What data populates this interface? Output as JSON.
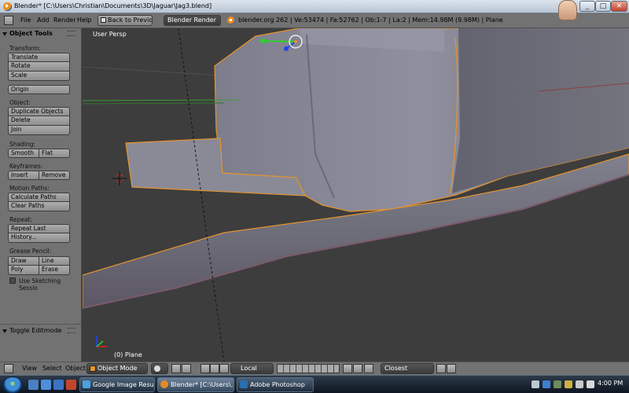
{
  "window": {
    "title": "Blender* [C:\\Users\\Christian\\Documents\\3D\\Jaguar\\Jag3.blend]",
    "minimize": "_",
    "maximize": "□",
    "close": "✕"
  },
  "header": {
    "menus": [
      "File",
      "Add",
      "Render",
      "Help"
    ],
    "back_button": "Back to Previous",
    "render_engine": "Blender Render",
    "stats": "blender.org 262 | Ve:53474 | Fa:52762 | Ob:1-7 | La:2 | Mem:14.98M (9.98M) | Plane"
  },
  "toolshelf": {
    "panel_title": "Object Tools",
    "transform_label": "Transform:",
    "translate": "Translate",
    "rotate": "Rotate",
    "scale": "Scale",
    "origin": "Origin",
    "object_label": "Object:",
    "duplicate_objects": "Duplicate Objects",
    "delete": "Delete",
    "join": "Join",
    "shading_label": "Shading:",
    "smooth": "Smooth",
    "flat": "Flat",
    "keyframes_label": "Keyframes:",
    "insert": "Insert",
    "remove": "Remove",
    "motion_paths_label": "Motion Paths:",
    "calculate_paths": "Calculate Paths",
    "clear_paths": "Clear Paths",
    "repeat_label": "Repeat:",
    "repeat_last": "Repeat Last",
    "history": "History...",
    "grease_pencil_label": "Grease Pencil:",
    "draw": "Draw",
    "line": "Line",
    "poly": "Poly",
    "erase": "Erase",
    "use_sketching": "Use Sketching Sessio",
    "toggle_editmode": "Toggle Editmode"
  },
  "viewport": {
    "view_label": "User Persp",
    "object_label": "(0) Plane"
  },
  "bottombar": {
    "menus": [
      "View",
      "Select",
      "Object"
    ],
    "mode": "Object Mode",
    "pivot": "Local",
    "snap": "Closest"
  },
  "taskbar": {
    "tasks": [
      "Google Image Resul...",
      "Blender* [C:\\Users\\...",
      "Adobe Photoshop"
    ],
    "clock": "4:00 PM"
  },
  "colors": {
    "ui_gray": "#727272",
    "viewport_bg": "#3d3d3d",
    "mesh": "#8e8e9c",
    "selection_outline": "#e3942f"
  }
}
